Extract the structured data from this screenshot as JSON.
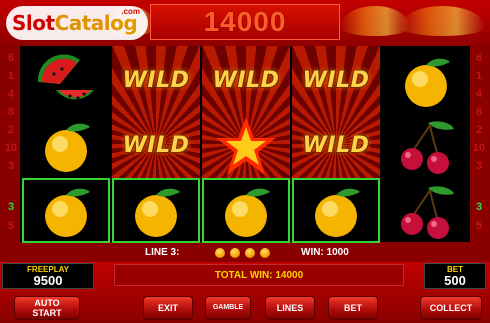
{
  "brand": {
    "name_part1": "Slot",
    "name_part2": "Catalog",
    "suffix": ".com"
  },
  "header": {
    "score": "14000"
  },
  "reels": {
    "row_numbers_left": [
      "6",
      "1",
      "4",
      "8",
      "2",
      "10",
      "3",
      "9",
      "5",
      "7"
    ],
    "row_numbers_right": [
      "6",
      "1",
      "4",
      "8",
      "2",
      "10",
      "3",
      "9",
      "5",
      "7"
    ],
    "active_line_label": "3",
    "columns": [
      {
        "type": "symbols",
        "symbols": [
          "watermelon",
          "orange",
          "orange"
        ]
      },
      {
        "type": "wild",
        "symbols": [
          "WILD",
          "WILD",
          "orange"
        ]
      },
      {
        "type": "wild-star",
        "symbols": [
          "WILD",
          "star",
          "orange"
        ]
      },
      {
        "type": "wild",
        "symbols": [
          "WILD",
          "WILD",
          "orange"
        ]
      },
      {
        "type": "symbols",
        "symbols": [
          "orange",
          "cherries",
          "cherries"
        ]
      }
    ],
    "wild_text": "WILD"
  },
  "info": {
    "line_label": "LINE 3:",
    "win_label": "WIN: 1000"
  },
  "panel": {
    "freeplay_label": "FREEPLAY",
    "freeplay_value": "9500",
    "total_win": "TOTAL WIN: 14000",
    "bet_label": "BET",
    "bet_value": "500"
  },
  "buttons": {
    "autostart": "AUTO\nSTART",
    "exit": "EXIT",
    "gamble": "GAMBLE",
    "lines": "LINES",
    "bet": "BET",
    "collect": "COLLECT"
  },
  "colors": {
    "win_frame": "#33d633",
    "accent_yellow": "#ffd400",
    "background_red": "#c00000"
  }
}
